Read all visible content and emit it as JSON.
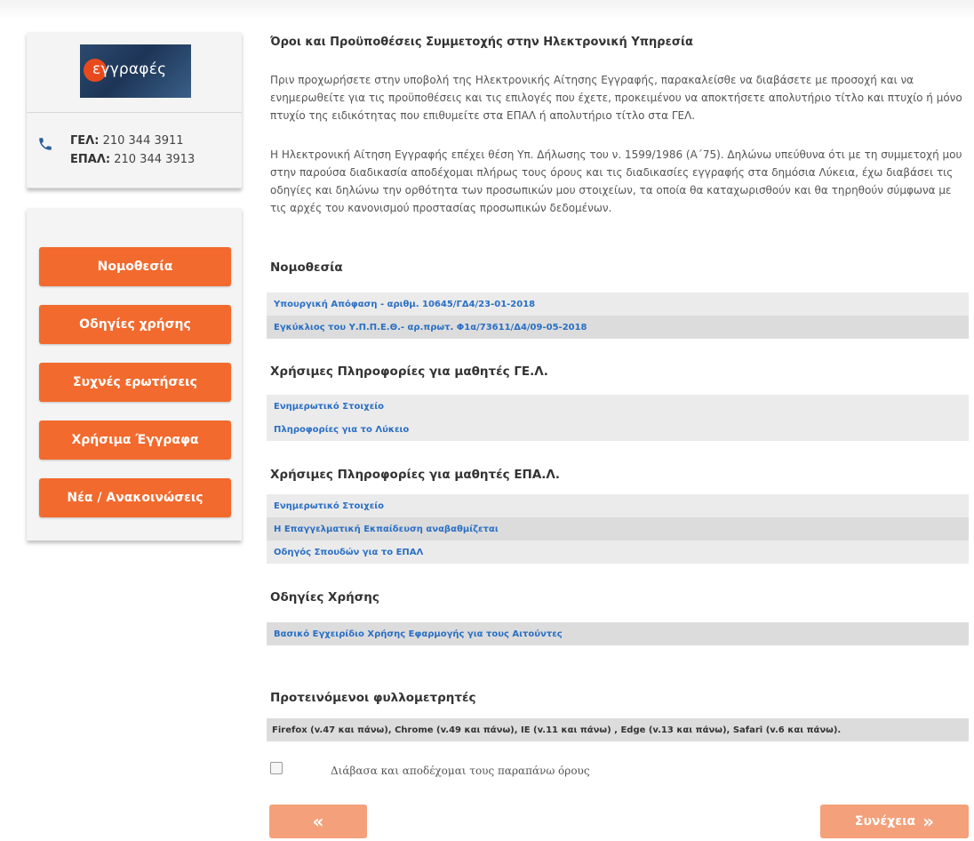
{
  "sidebar": {
    "logo_text": "εγγραφές",
    "phones": [
      {
        "label": "ΓΕΛ:",
        "number": "210 344 3911"
      },
      {
        "label": "ΕΠΑΛ:",
        "number": "210 344 3913"
      }
    ],
    "menu": [
      {
        "label": "Νομοθεσία"
      },
      {
        "label": "Οδηγίες χρήσης"
      },
      {
        "label": "Συχνές ερωτήσεις"
      },
      {
        "label": "Χρήσιμα Έγγραφα"
      },
      {
        "label": "Νέα / Ανακοινώσεις"
      }
    ]
  },
  "main": {
    "title": "Όροι και Προϋποθέσεις Συμμετοχής στην Ηλεκτρονική Υπηρεσία",
    "para1": "Πριν προχωρήσετε στην υποβολή της Ηλεκτρονικής Αίτησης Εγγραφής, παρακαλείσθε να διαβάσετε με προσοχή και να ενημερωθείτε για τις προϋποθέσεις και τις επιλογές που έχετε, προκειμένου να αποκτήσετε απολυτήριο τίτλο και πτυχίο ή μόνο πτυχίο της ειδικότητας που επιθυμείτε στα ΕΠΑΛ ή απολυτήριο τίτλο στα ΓΕΛ.",
    "para2": "Η Ηλεκτρονική Αίτηση Εγγραφής επέχει θέση Υπ. Δήλωσης του ν. 1599/1986 (Α΄75). Δηλώνω υπεύθυνα ότι με τη συμμετοχή μου στην παρούσα διαδικασία αποδέχομαι πλήρως τους όρους και τις διαδικασίες εγγραφής στα δημόσια Λύκεια, έχω διαβάσει τις οδηγίες και δηλώνω την ορθότητα των προσωπικών μου στοιχείων, τα οποία θα καταχωρισθούν και θα τηρηθούν σύμφωνα με τις αρχές του κανονισμού προστασίας προσωπικών δεδομένων.",
    "sections": {
      "nomothesia": {
        "title": "Νομοθεσία",
        "links": [
          "Υπουργική Απόφαση - αριθμ. 10645/ΓΔ4/23-01-2018",
          "Εγκύκλιος του Υ.Π.Π.Ε.Θ.- αρ.πρωτ. Φ1α/73611/Δ4/09-05-2018"
        ]
      },
      "gel": {
        "title": "Χρήσιμες Πληροφορίες για μαθητές ΓΕ.Λ.",
        "links": [
          "Ενημερωτικό Στοιχείο",
          "Πληροφορίες για το Λύκειο"
        ]
      },
      "epal": {
        "title": "Χρήσιμες Πληροφορίες για μαθητές ΕΠΑ.Λ.",
        "links": [
          "Ενημερωτικό Στοιχείο",
          "Η Επαγγελματική Εκπαίδευση αναβαθμίζεται",
          "Οδηγός Σπουδών για το ΕΠΑΛ"
        ]
      },
      "odigies": {
        "title": "Οδηγίες Χρήσης",
        "links": [
          "Βασικό Εγχειρίδιο Χρήσης Εφαρμογής για τους Αιτούντες"
        ]
      },
      "browsers": {
        "title": "Προτεινόμενοι φυλλομετρητές",
        "text": "Firefox (v.47 και πάνω), Chrome (v.49 και πάνω), IE (v.11 και πάνω) , Edge (v.13 και πάνω), Safari (v.6 και πάνω)."
      }
    },
    "accept_label": "Διάβασα και αποδέχομαι τους παραπάνω όρους",
    "back_icon": "«",
    "next_label": "Συνέχεια",
    "next_icon": "»"
  },
  "colors": {
    "accent": "#f26a2e",
    "accent_disabled": "#f4a07a",
    "link": "#2a6fc4"
  }
}
